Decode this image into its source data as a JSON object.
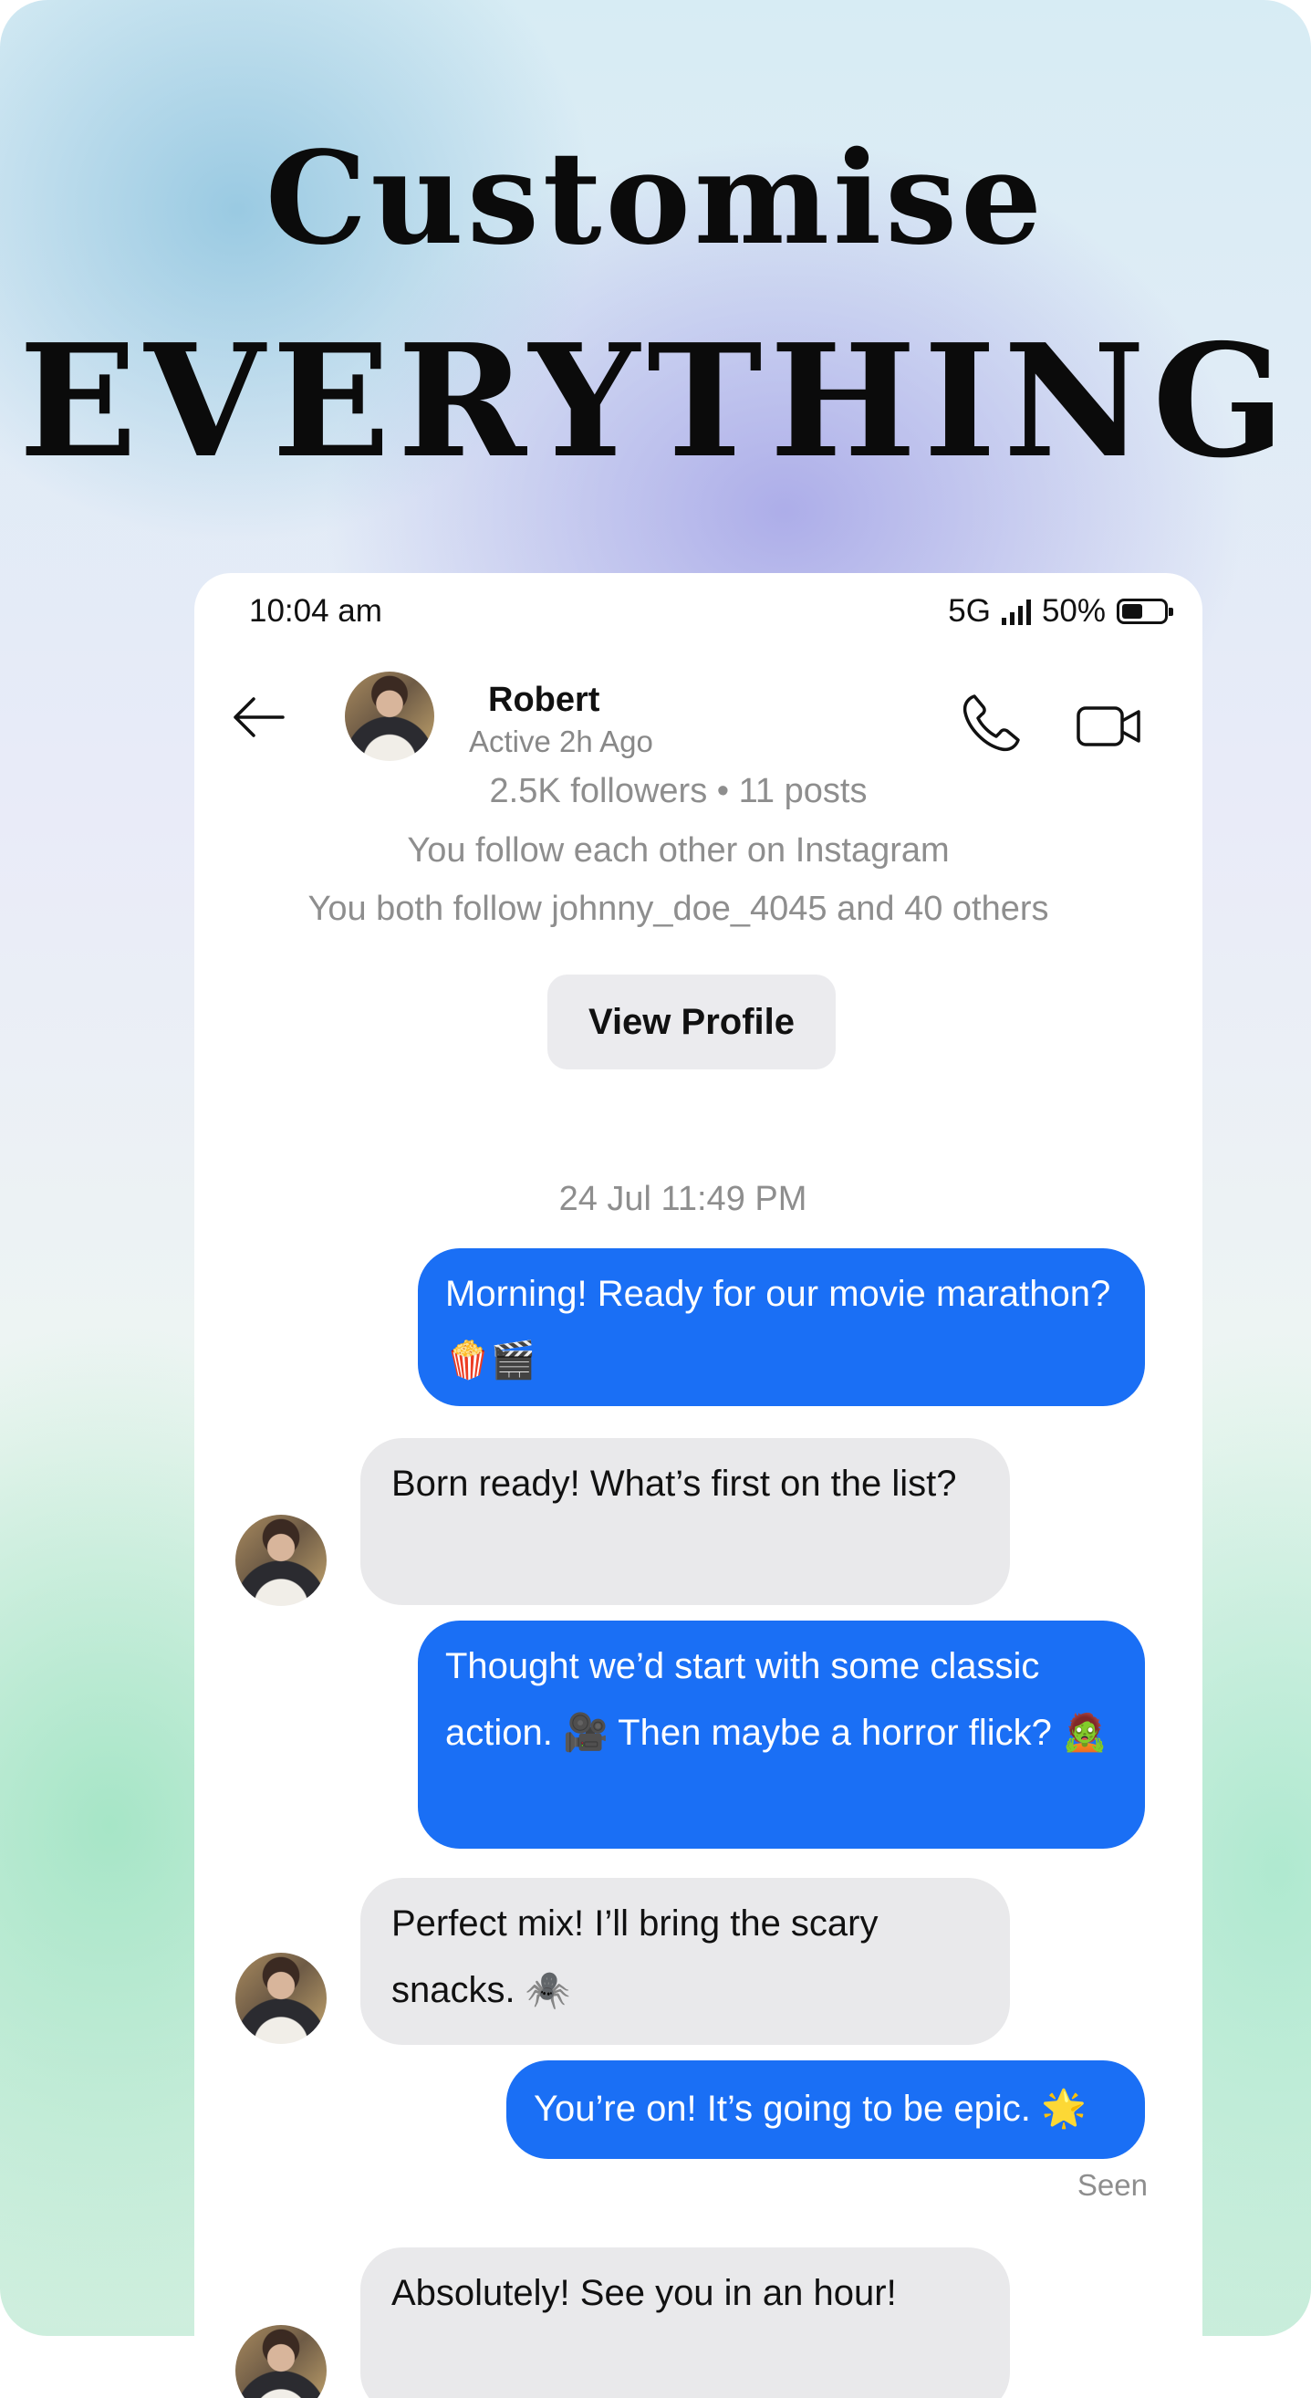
{
  "promo": {
    "line1": "Customise",
    "line2": "EVERYTHING"
  },
  "status_bar": {
    "time": "10:04 am",
    "network": "5G",
    "battery": "50%"
  },
  "header": {
    "name": "Robert",
    "subtitle": "Active 2h Ago",
    "icons": [
      "back-arrow-icon",
      "phone-icon",
      "video-camera-icon"
    ]
  },
  "profile_info": {
    "stats": "2.5K followers • 11 posts",
    "follow_status": "You follow each other on Instagram",
    "mutuals": "You both follow  johnny_doe_4045 and  40 others",
    "view_profile_label": "View Profile"
  },
  "chat": {
    "date_separator": "24 Jul 11:49 PM",
    "messages": [
      {
        "from": "me",
        "text": "Morning! Ready for our movie marathon? 🍿🎬"
      },
      {
        "from": "them",
        "text": "Born ready! What’s first on the list?"
      },
      {
        "from": "me",
        "text": "Thought we’d start with some classic action. 🎥 Then maybe a horror flick? 🧟"
      },
      {
        "from": "them",
        "text": "Perfect mix! I’ll bring the scary snacks. 🕷️"
      },
      {
        "from": "me",
        "text": "You’re on! It’s going to be epic. 🌟"
      },
      {
        "from": "them",
        "text": "Absolutely! See you in an hour!"
      }
    ],
    "seen_label": "Seen"
  },
  "colors": {
    "outgoing_bubble": "#1a6ff5",
    "incoming_bubble": "#e9e9eb"
  }
}
